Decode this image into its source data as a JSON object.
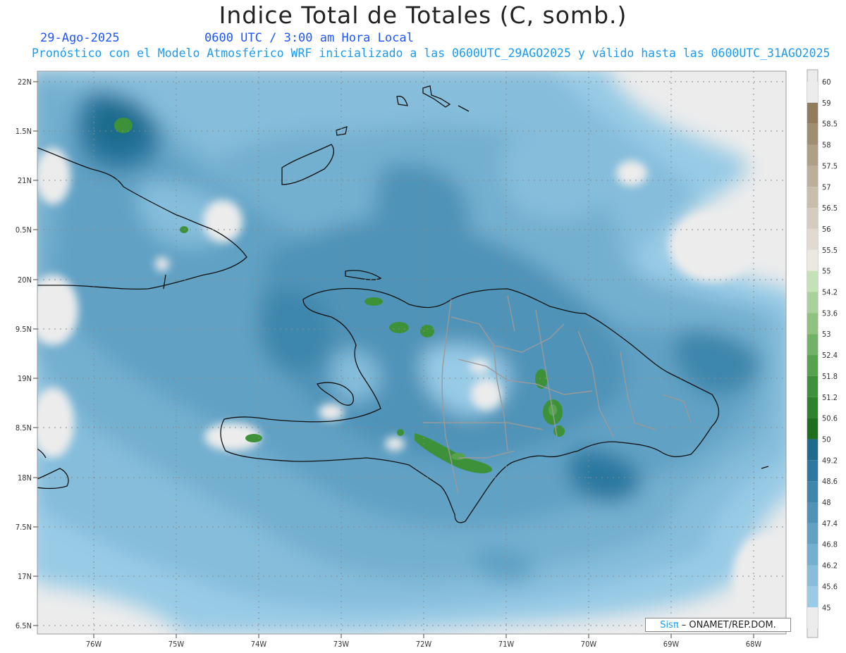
{
  "header": {
    "title": "Indice Total de Totales (C, somb.)",
    "date": "29-Ago-2025",
    "time": "0600 UTC / 3:00 am Hora Local",
    "description": "Pronóstico con el Modelo Atmosférico WRF inicializado a las 0600UTC_29AGO2025 y válido hasta las  0600UTC_31AGO2025"
  },
  "axes": {
    "lat_labels": [
      "22N",
      "1.5N",
      "21N",
      "0.5N",
      "20N",
      "9.5N",
      "19N",
      "8.5N",
      "18N",
      "7.5N",
      "17N",
      "6.5N"
    ],
    "lon_labels": [
      "76W",
      "75W",
      "74W",
      "73W",
      "72W",
      "71W",
      "70W",
      "69W",
      "68W"
    ]
  },
  "colorbar": {
    "labels": [
      "60",
      "59",
      "58.5",
      "58",
      "57.5",
      "57",
      "56.5",
      "56",
      "55.5",
      "55",
      "54.2",
      "53.6",
      "53",
      "52.4",
      "51.8",
      "51.2",
      "50.6",
      "50",
      "49.2",
      "48.6",
      "48",
      "47.4",
      "46.8",
      "46.2",
      "45.6",
      "45"
    ],
    "colors": [
      "#ececec",
      "#917d5c",
      "#a08e72",
      "#ae9f86",
      "#bcae98",
      "#c8bea9",
      "#d4ccbd",
      "#e0dacf",
      "#ece8e1",
      "#c4e2b7",
      "#a9d29b",
      "#8dc27f",
      "#71b264",
      "#57a24d",
      "#3d9239",
      "#2c8329",
      "#1d6f1e",
      "#1f6b8c",
      "#2c78a0",
      "#3d86ac",
      "#4f93b8",
      "#61a1c4",
      "#73afcf",
      "#85bddb",
      "#98cbe6",
      "#ececec"
    ]
  },
  "map_data": {
    "region": "La Española / Hispaniola",
    "variable": "Indice Total de Totales",
    "units": "C"
  },
  "credit": {
    "logo": "Sisπ",
    "text": " – ONAMET/REP.DOM."
  }
}
